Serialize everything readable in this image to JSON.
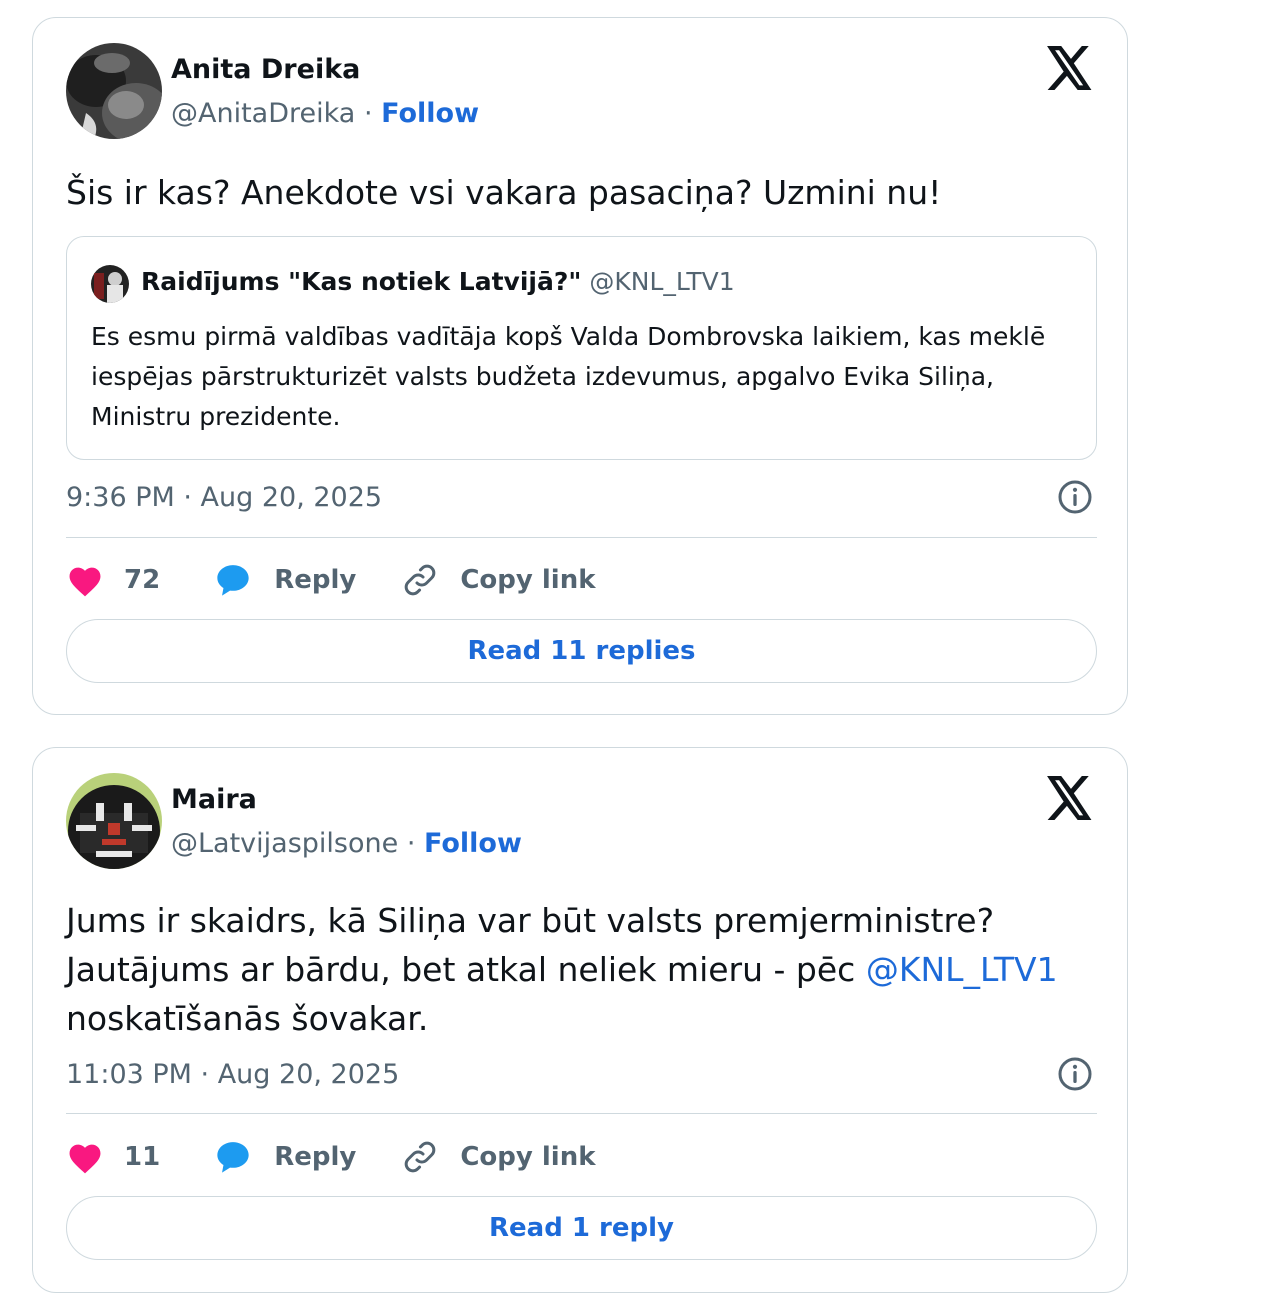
{
  "tweets": [
    {
      "author_name": "Anita Dreika",
      "handle": "@AnitaDreika",
      "separator": "·",
      "follow_label": "Follow",
      "text": "Šis ir kas? Anekdote vsi vakara pasaciņa? Uzmini nu!",
      "quote": {
        "name": "Raidījums \"Kas notiek Latvijā?\"",
        "handle": "@KNL_LTV1",
        "text": "Es esmu pirmā valdības vadītāja kopš Valda Dombrovska laikiem, kas meklē iespējas pārstrukturizēt valsts budžeta izdevumus, apgalvo Evika Siliņa, Ministru prezidente."
      },
      "timestamp": "9:36 PM · Aug 20, 2025",
      "likes": "72",
      "reply_label": "Reply",
      "copy_label": "Copy link",
      "read_replies": "Read 11 replies"
    },
    {
      "author_name": "Maira",
      "handle": "@Latvijaspilsone",
      "separator": "·",
      "follow_label": "Follow",
      "text_before": "Jums ir skaidrs, kā Siliņa var būt valsts premjerministre? Jautājums ar bārdu, bet atkal neliek mieru - pēc ",
      "mention": "@KNL_LTV1",
      "text_after": " noskatīšanās šovakar.",
      "timestamp": "11:03 PM · Aug 20, 2025",
      "likes": "11",
      "reply_label": "Reply",
      "copy_label": "Copy link",
      "read_replies": "Read 1 reply"
    }
  ],
  "icons": {
    "brand": "x-logo-icon",
    "like": "heart-icon",
    "reply": "speech-bubble-icon",
    "copy": "link-icon",
    "info": "info-icon"
  },
  "colors": {
    "accent": "#1d6ad8",
    "heart": "#f91880",
    "reply_bubble": "#1d9bf0",
    "muted": "#536471",
    "border": "#cfd9de"
  }
}
